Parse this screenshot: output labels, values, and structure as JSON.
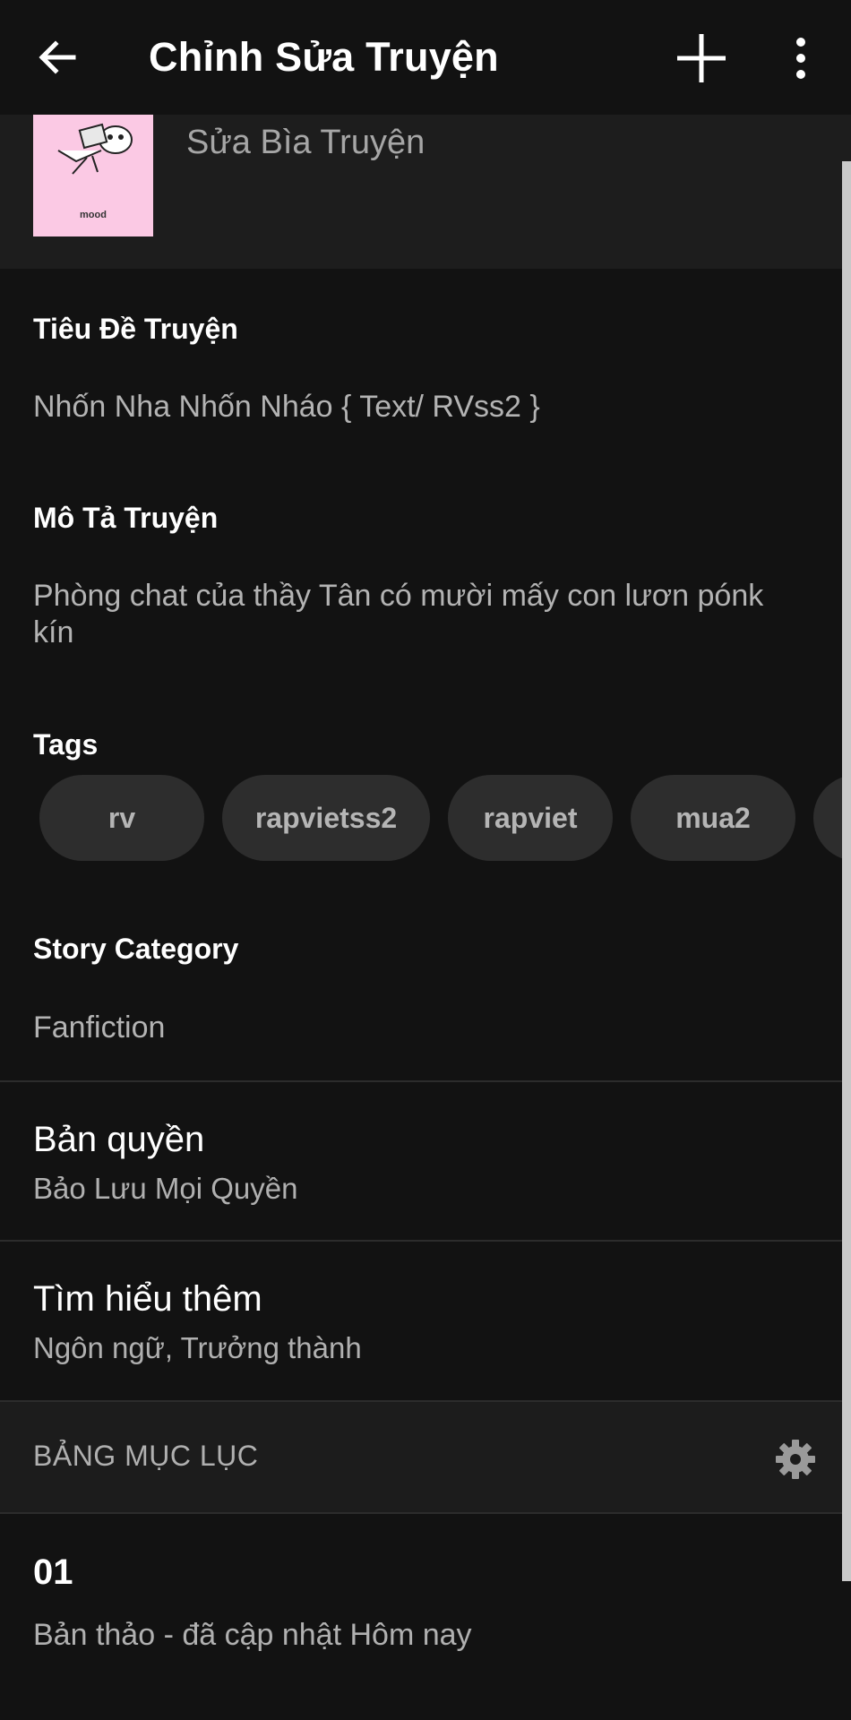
{
  "appbar": {
    "title": "Chỉnh Sửa Truyện",
    "back_icon": "arrow-left-icon",
    "add_icon": "plus-icon",
    "more_icon": "more-vertical-icon"
  },
  "cover": {
    "label": "Sửa Bìa Truyện",
    "image_caption": "mood"
  },
  "title_field": {
    "label": "Tiêu Đề Truyện",
    "value": "Nhốn Nha Nhốn Nháo { Text/ RVss2 }"
  },
  "description_field": {
    "label": "Mô Tả Truyện",
    "value": "Phòng chat của thầy Tân có mười mấy con lươn pónk kín"
  },
  "tags": {
    "label": "Tags",
    "items": [
      "rv",
      "rapvietss2",
      "rapviet",
      "mua2"
    ]
  },
  "category": {
    "label": "Story Category",
    "value": "Fanfiction"
  },
  "copyright": {
    "title": "Bản quyền",
    "value": "Bảo Lưu Mọi Quyền"
  },
  "more_info": {
    "title": "Tìm hiểu thêm",
    "value": "Ngôn ngữ, Trưởng thành"
  },
  "toc": {
    "header": "BẢNG MỤC LỤC",
    "settings_icon": "gear-icon",
    "parts": [
      {
        "title": "01",
        "status": "Bản thảo - đã cập nhật Hôm nay"
      }
    ]
  },
  "colors": {
    "background": "#121212",
    "section_bg": "#1d1d1d",
    "tag_bg": "#2d2d2d",
    "cover_pink": "#fbc9e4"
  }
}
